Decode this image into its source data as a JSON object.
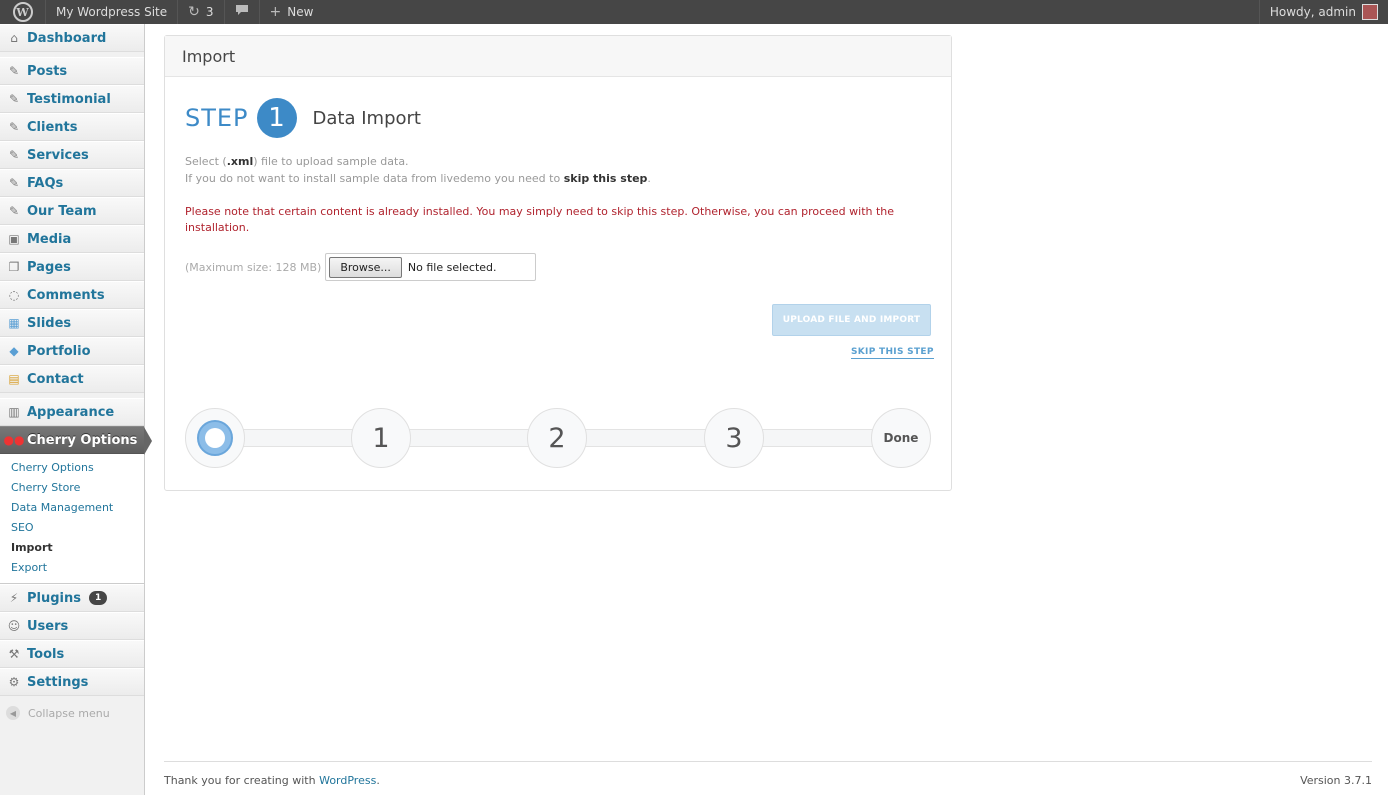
{
  "adminbar": {
    "site_name": "My Wordpress Site",
    "updates_count": "3",
    "new_label": "New",
    "howdy": "Howdy, admin"
  },
  "sidebar": {
    "items": [
      {
        "label": "Dashboard",
        "icon": "dashboard-icon"
      },
      {
        "label": "Posts",
        "icon": "pin-icon"
      },
      {
        "label": "Testimonial",
        "icon": "pin-icon"
      },
      {
        "label": "Clients",
        "icon": "pin-icon"
      },
      {
        "label": "Services",
        "icon": "pin-icon"
      },
      {
        "label": "FAQs",
        "icon": "pin-icon"
      },
      {
        "label": "Our Team",
        "icon": "pin-icon"
      },
      {
        "label": "Media",
        "icon": "media-icon"
      },
      {
        "label": "Pages",
        "icon": "pages-icon"
      },
      {
        "label": "Comments",
        "icon": "comments-icon"
      },
      {
        "label": "Slides",
        "icon": "slides-icon"
      },
      {
        "label": "Portfolio",
        "icon": "portfolio-icon"
      },
      {
        "label": "Contact",
        "icon": "contact-icon"
      },
      {
        "label": "Appearance",
        "icon": "appearance-icon"
      },
      {
        "label": "Cherry Options",
        "icon": "cherry-icon"
      },
      {
        "label": "Plugins",
        "icon": "plugin-icon",
        "badge": "1"
      },
      {
        "label": "Users",
        "icon": "users-icon"
      },
      {
        "label": "Tools",
        "icon": "tools-icon"
      },
      {
        "label": "Settings",
        "icon": "settings-icon"
      }
    ],
    "submenu": [
      "Cherry Options",
      "Cherry Store",
      "Data Management",
      "SEO",
      "Import",
      "Export"
    ],
    "collapse_label": "Collapse menu"
  },
  "panel": {
    "title": "Import",
    "step_word": "STEP",
    "step_number": "1",
    "step_title": "Data Import",
    "desc_line1_pre": "Select (",
    "desc_line1_bold": ".xml",
    "desc_line1_post": ") file to upload sample data.",
    "desc_line2_pre": "If you do not want to install sample data from livedemo you need to ",
    "desc_line2_bold": "skip this step",
    "desc_line2_post": ".",
    "notice": "Please note that certain content is already installed. You may simply need to skip this step. Otherwise, you can proceed with the installation.",
    "max_size": "(Maximum size: 128 MB)",
    "browse_label": "Browse...",
    "file_status": "No file selected.",
    "upload_label": "UPLOAD FILE AND IMPORT",
    "skip_label": "SKIP THIS STEP",
    "progress_nodes": [
      "1",
      "2",
      "3"
    ],
    "progress_done": "Done"
  },
  "footer": {
    "thanks_pre": "Thank you for creating with ",
    "thanks_link": "WordPress",
    "thanks_post": ".",
    "version": "Version 3.7.1"
  },
  "colors": {
    "accent": "#3d8ac7",
    "link": "#21759b",
    "notice": "#b0232e",
    "adminbar": "#464646"
  }
}
